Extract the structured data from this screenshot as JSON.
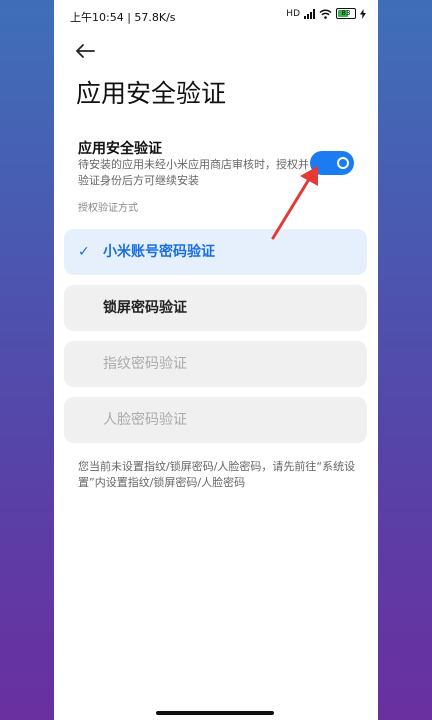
{
  "status_bar": {
    "time": "上午10:54 | 57.8K/s",
    "network": "HD",
    "battery": "83"
  },
  "header": {
    "title": "应用安全验证"
  },
  "security": {
    "title": "应用安全验证",
    "description": "待安装的应用未经小米应用商店审核时，授权并验证身份后方可继续安装",
    "toggle_state": "on"
  },
  "methods": {
    "label": "授权验证方式",
    "options": [
      {
        "label": "小米账号密码验证",
        "state": "selected"
      },
      {
        "label": "锁屏密码验证",
        "state": "enabled"
      },
      {
        "label": "指纹密码验证",
        "state": "disabled"
      },
      {
        "label": "人脸密码验证",
        "state": "disabled"
      }
    ]
  },
  "note": "您当前未设置指纹/锁屏密码/人脸密码，请先前往“系统设置”内设置指纹/锁屏密码/人脸密码",
  "colors": {
    "accent": "#1a7cf0",
    "annotation_arrow": "#e53935"
  }
}
